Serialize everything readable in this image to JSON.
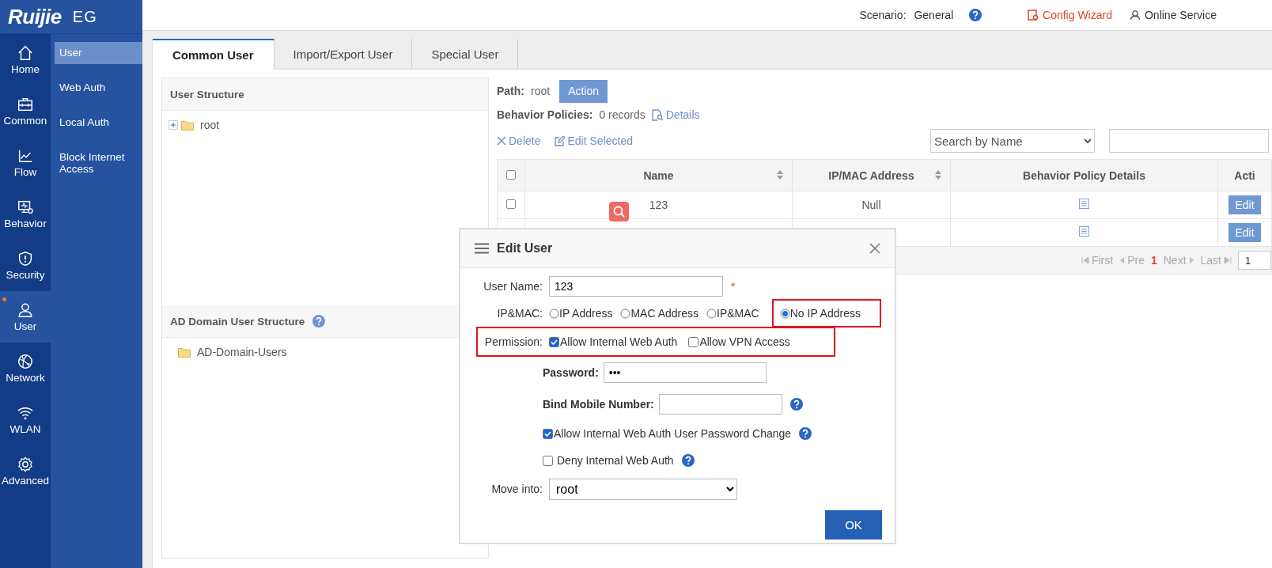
{
  "logo": {
    "brand": "Ruijie",
    "product": "EG"
  },
  "header": {
    "scenario_label": "Scenario:",
    "scenario": "General",
    "links": [
      {
        "kind": "wizard",
        "label": "Config Wizard"
      },
      {
        "kind": "service",
        "label": "Online Service"
      }
    ]
  },
  "nav": [
    {
      "label": "Home",
      "selected": false,
      "alert": false
    },
    {
      "label": "Common",
      "selected": false,
      "alert": false
    },
    {
      "label": "Flow",
      "selected": false,
      "alert": false
    },
    {
      "label": "Behavior",
      "selected": false,
      "alert": false
    },
    {
      "label": "Security",
      "selected": false,
      "alert": false
    },
    {
      "label": "User",
      "selected": true,
      "alert": true
    },
    {
      "label": "Network",
      "selected": false,
      "alert": false
    },
    {
      "label": "WLAN",
      "selected": false,
      "alert": false
    },
    {
      "label": "Advanced",
      "selected": false,
      "alert": false
    }
  ],
  "submenu": [
    {
      "label": "User",
      "selected": true
    },
    {
      "label": "Web Auth",
      "selected": false
    },
    {
      "label": "Local Auth",
      "selected": false
    },
    {
      "label": "Block Internet Access",
      "selected": false
    }
  ],
  "tabs": [
    {
      "label": "Common User",
      "selected": true
    },
    {
      "label": "Import/Export User",
      "selected": false
    },
    {
      "label": "Special User",
      "selected": false
    }
  ],
  "user_structure": {
    "title": "User Structure",
    "tree": [
      {
        "label": "root",
        "expanded": false
      }
    ]
  },
  "ad_structure": {
    "title": "AD Domain User Structure",
    "tree": [
      {
        "label": "AD-Domain-Users"
      }
    ]
  },
  "path": {
    "label": "Path:",
    "value": "root",
    "action": "Action"
  },
  "policies": {
    "label": "Behavior Policies:",
    "value": "0 records",
    "link": "Details"
  },
  "toolbar": [
    {
      "kind": "delete",
      "label": "Delete"
    },
    {
      "kind": "edit",
      "label": "Edit Selected"
    }
  ],
  "search": {
    "field": "Search by Name"
  },
  "table": {
    "select_all_checked": false,
    "columns": [
      {
        "label": "Name",
        "sortable": true
      },
      {
        "label": "IP/MAC Address",
        "sortable": true
      },
      {
        "label": "Behavior Policy Details",
        "sortable": false
      },
      {
        "label": "Acti",
        "sortable": false
      }
    ],
    "rows": [
      {
        "checked": false,
        "name": "123",
        "address": "Null",
        "action": "Edit"
      },
      {
        "action": "Edit"
      }
    ]
  },
  "pagination": {
    "first": "First",
    "prev": "Pre",
    "current": "1",
    "next": "Next",
    "last": "Last",
    "page": "1"
  },
  "dialog": {
    "title": "Edit User",
    "fields": [
      {
        "kind": "text",
        "label": "User Name:",
        "value": "123",
        "required_mark": "*"
      },
      {
        "kind": "radio",
        "label": "IP&MAC:",
        "options": [
          {
            "label": "IP Address",
            "selected": false,
            "highlighted": false
          },
          {
            "label": "MAC Address",
            "selected": false,
            "highlighted": false
          },
          {
            "label": "IP&MAC",
            "selected": false,
            "highlighted": false
          },
          {
            "label": "No IP Address",
            "selected": true,
            "highlighted": true
          }
        ]
      },
      {
        "kind": "checks",
        "label": "Permission:",
        "highlighted": true,
        "options": [
          {
            "label": "Allow Internal Web Auth",
            "checked": true
          },
          {
            "label": "Allow VPN Access",
            "checked": false
          }
        ]
      },
      {
        "kind": "text",
        "bold": true,
        "label": "Password:",
        "value": "•••"
      },
      {
        "kind": "text",
        "bold": true,
        "label": "Bind Mobile Number:",
        "help": true
      },
      {
        "kind": "check",
        "label": "Allow Internal Web Auth User Password Change",
        "checked": true,
        "help": true
      },
      {
        "kind": "check",
        "label": "Deny Internal Web Auth",
        "checked": false,
        "help": true
      },
      {
        "kind": "select",
        "label": "Move into:",
        "value": "root"
      }
    ],
    "ok": "OK"
  }
}
